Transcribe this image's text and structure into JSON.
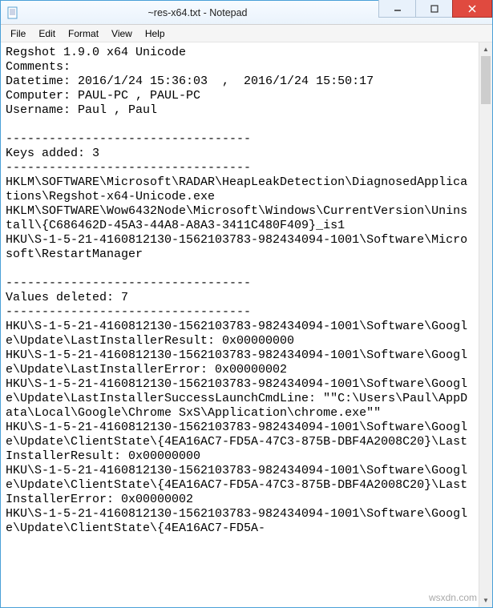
{
  "window": {
    "title": "~res-x64.txt - Notepad"
  },
  "menubar": {
    "items": [
      "File",
      "Edit",
      "Format",
      "View",
      "Help"
    ]
  },
  "document": {
    "text": "Regshot 1.9.0 x64 Unicode\nComments:\nDatetime: 2016/1/24 15:36:03  ,  2016/1/24 15:50:17\nComputer: PAUL-PC , PAUL-PC\nUsername: Paul , Paul\n\n----------------------------------\nKeys added: 3\n----------------------------------\nHKLM\\SOFTWARE\\Microsoft\\RADAR\\HeapLeakDetection\\DiagnosedApplications\\Regshot-x64-Unicode.exe\nHKLM\\SOFTWARE\\Wow6432Node\\Microsoft\\Windows\\CurrentVersion\\Uninstall\\{C686462D-45A3-44A8-A8A3-3411C480F409}_is1\nHKU\\S-1-5-21-4160812130-1562103783-982434094-1001\\Software\\Microsoft\\RestartManager\n\n----------------------------------\nValues deleted: 7\n----------------------------------\nHKU\\S-1-5-21-4160812130-1562103783-982434094-1001\\Software\\Google\\Update\\LastInstallerResult: 0x00000000\nHKU\\S-1-5-21-4160812130-1562103783-982434094-1001\\Software\\Google\\Update\\LastInstallerError: 0x00000002\nHKU\\S-1-5-21-4160812130-1562103783-982434094-1001\\Software\\Google\\Update\\LastInstallerSuccessLaunchCmdLine: \"\"C:\\Users\\Paul\\AppData\\Local\\Google\\Chrome SxS\\Application\\chrome.exe\"\"\nHKU\\S-1-5-21-4160812130-1562103783-982434094-1001\\Software\\Google\\Update\\ClientState\\{4EA16AC7-FD5A-47C3-875B-DBF4A2008C20}\\LastInstallerResult: 0x00000000\nHKU\\S-1-5-21-4160812130-1562103783-982434094-1001\\Software\\Google\\Update\\ClientState\\{4EA16AC7-FD5A-47C3-875B-DBF4A2008C20}\\LastInstallerError: 0x00000002\nHKU\\S-1-5-21-4160812130-1562103783-982434094-1001\\Software\\Google\\Update\\ClientState\\{4EA16AC7-FD5A-"
  },
  "watermark": "wsxdn.com"
}
